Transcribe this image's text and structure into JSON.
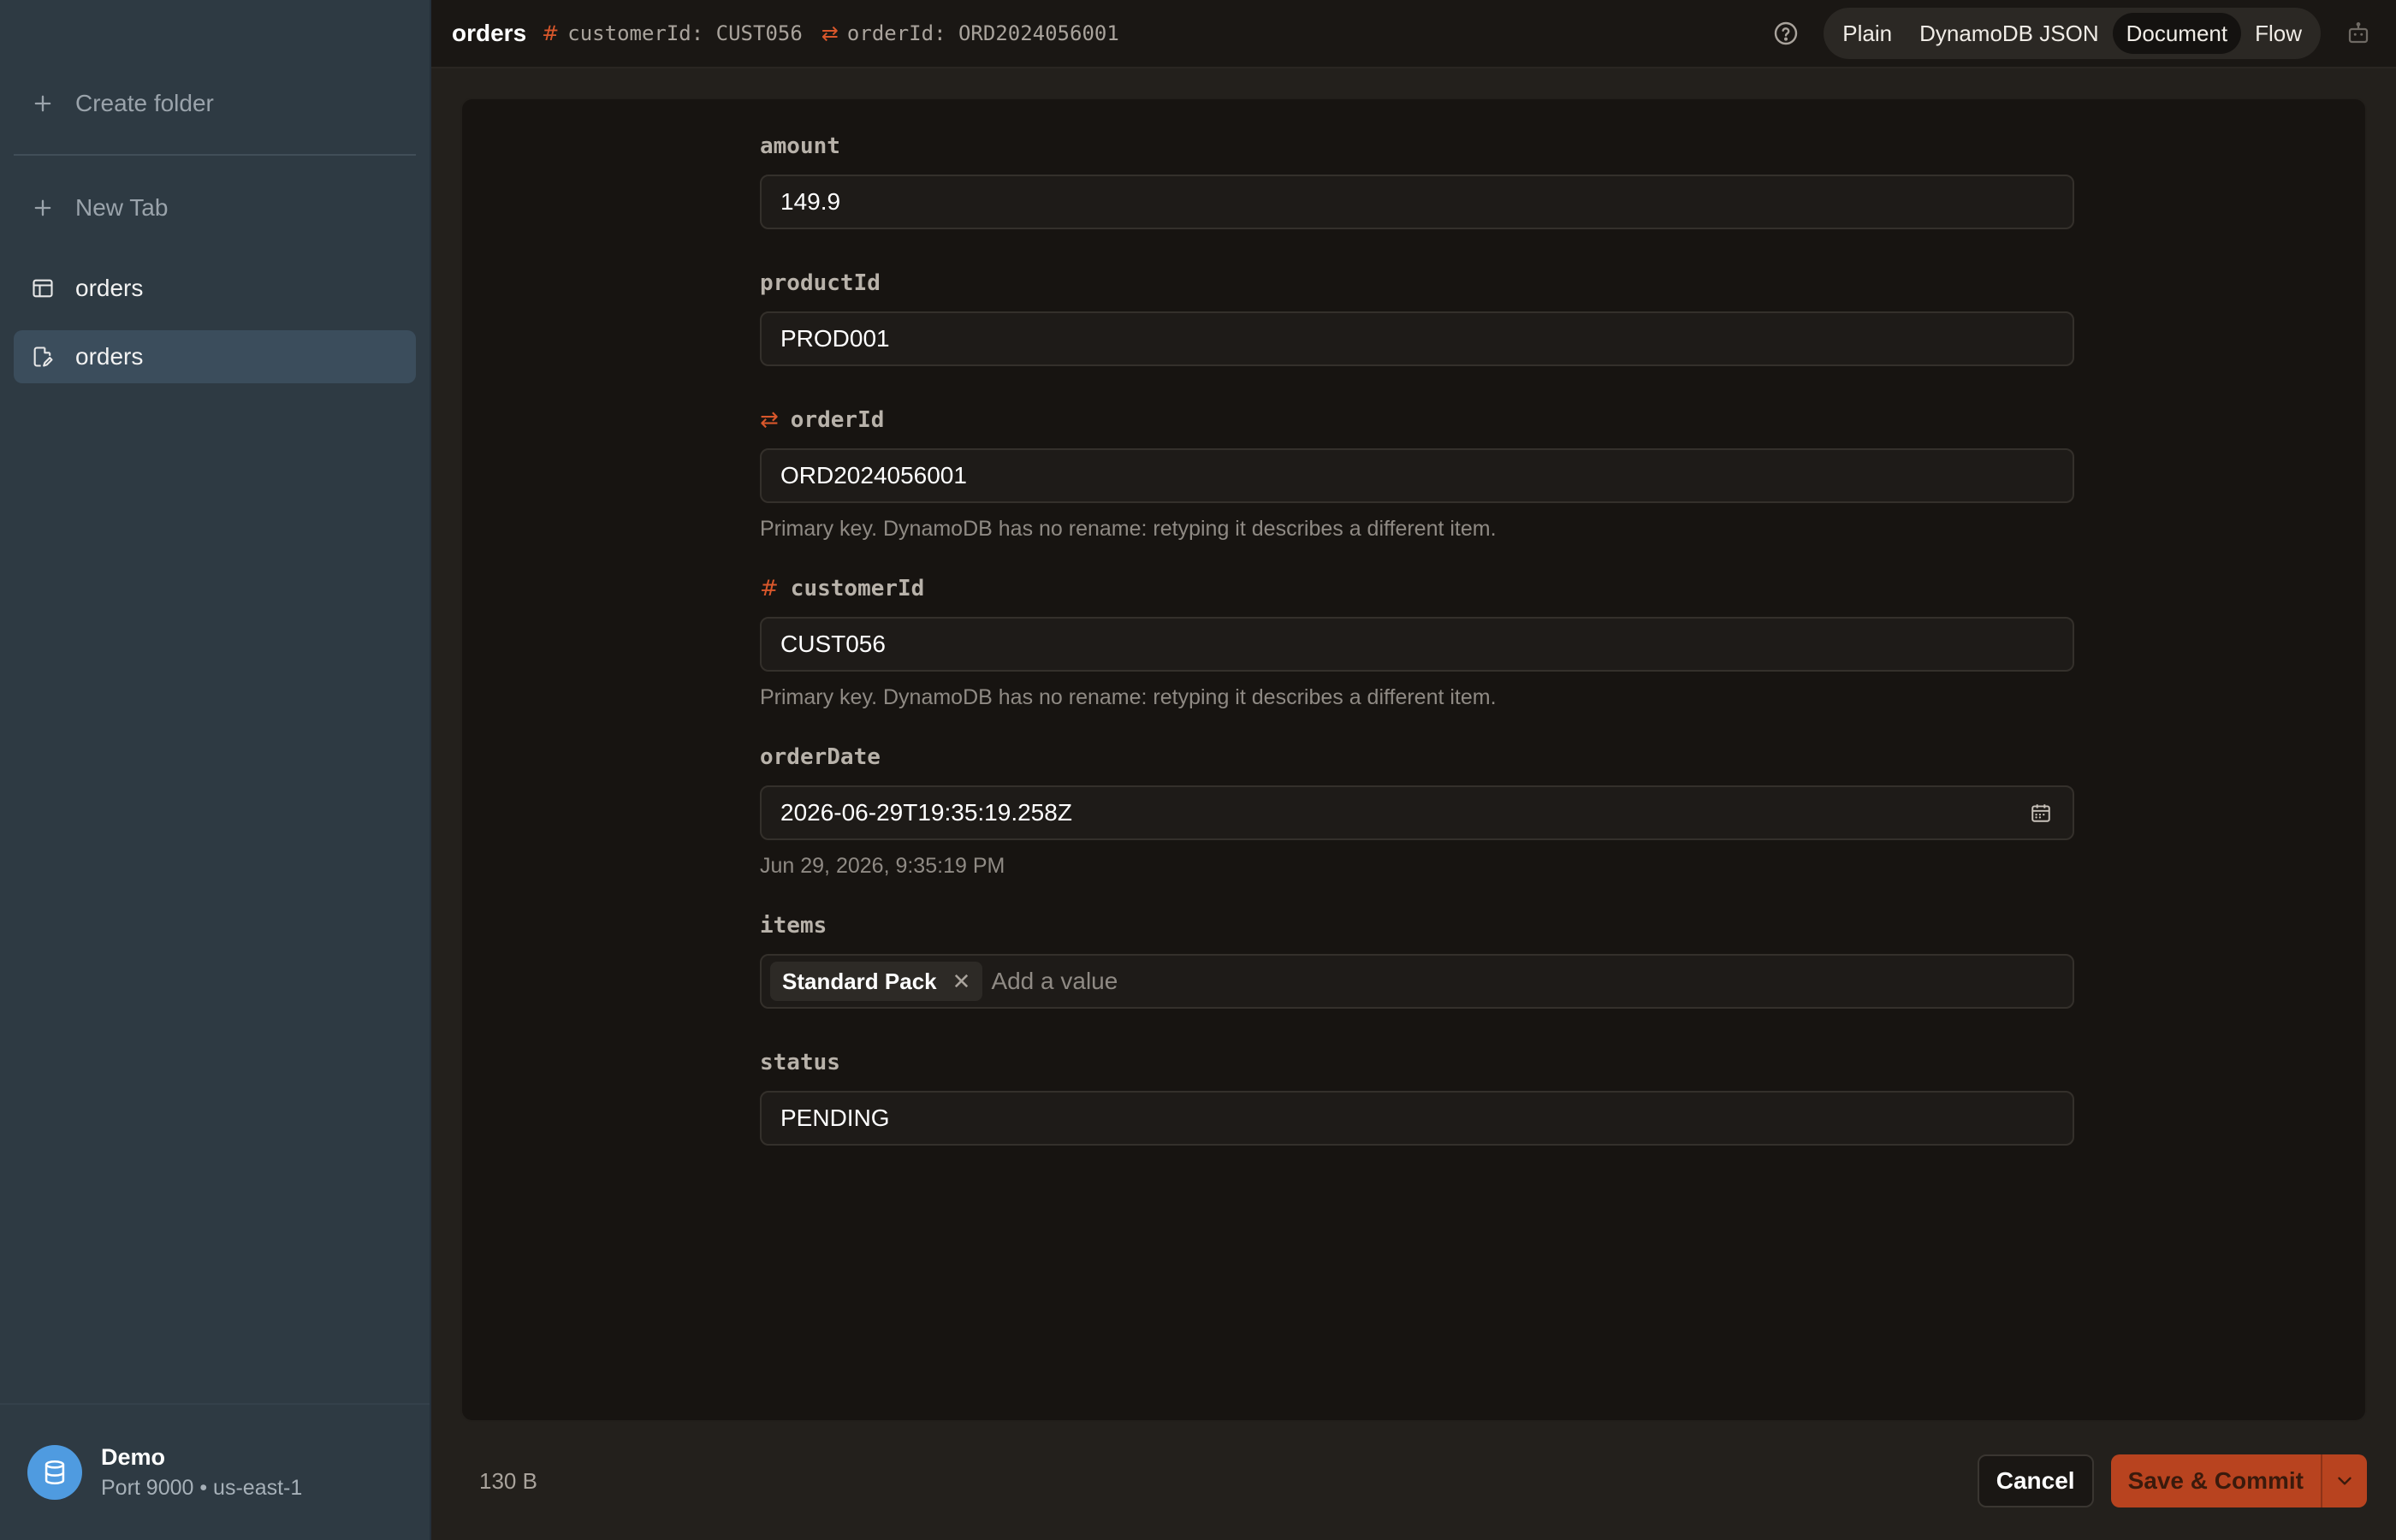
{
  "sidebar": {
    "create_folder": "Create folder",
    "new_tab": "New Tab",
    "items": [
      {
        "label": "orders",
        "icon": "table-icon"
      },
      {
        "label": "orders",
        "icon": "document-edit-icon",
        "active": true
      }
    ],
    "connection": {
      "name": "Demo",
      "details": "Port 9000 • us-east-1"
    }
  },
  "topbar": {
    "title": "orders",
    "keys": [
      {
        "symbol": "#",
        "text": "customerId: CUST056"
      },
      {
        "symbol": "⇄",
        "text": "orderId: ORD2024056001"
      }
    ],
    "view_modes": [
      "Plain",
      "DynamoDB JSON",
      "Document",
      "Flow"
    ],
    "active_view": "Document"
  },
  "form": {
    "amount": {
      "label": "amount",
      "value": "149.9"
    },
    "productId": {
      "label": "productId",
      "value": "PROD001"
    },
    "orderId": {
      "label": "orderId",
      "symbol": "⇄",
      "value": "ORD2024056001",
      "hint": "Primary key. DynamoDB has no rename: retyping it describes a different item."
    },
    "customerId": {
      "label": "customerId",
      "symbol": "#",
      "value": "CUST056",
      "hint": "Primary key. DynamoDB has no rename: retyping it describes a different item."
    },
    "orderDate": {
      "label": "orderDate",
      "value": "2026-06-29T19:35:19.258Z",
      "hint": "Jun 29, 2026, 9:35:19 PM"
    },
    "items": {
      "label": "items",
      "chips": [
        "Standard Pack"
      ],
      "placeholder": "Add a value"
    },
    "status": {
      "label": "status",
      "value": "PENDING"
    }
  },
  "footer": {
    "size": "130 B",
    "cancel": "Cancel",
    "save": "Save & Commit"
  },
  "colors": {
    "sidebar": "#2e3a43",
    "accent": "#d9572b",
    "save_button": "#b8431f",
    "avatar": "#4f9be0"
  }
}
